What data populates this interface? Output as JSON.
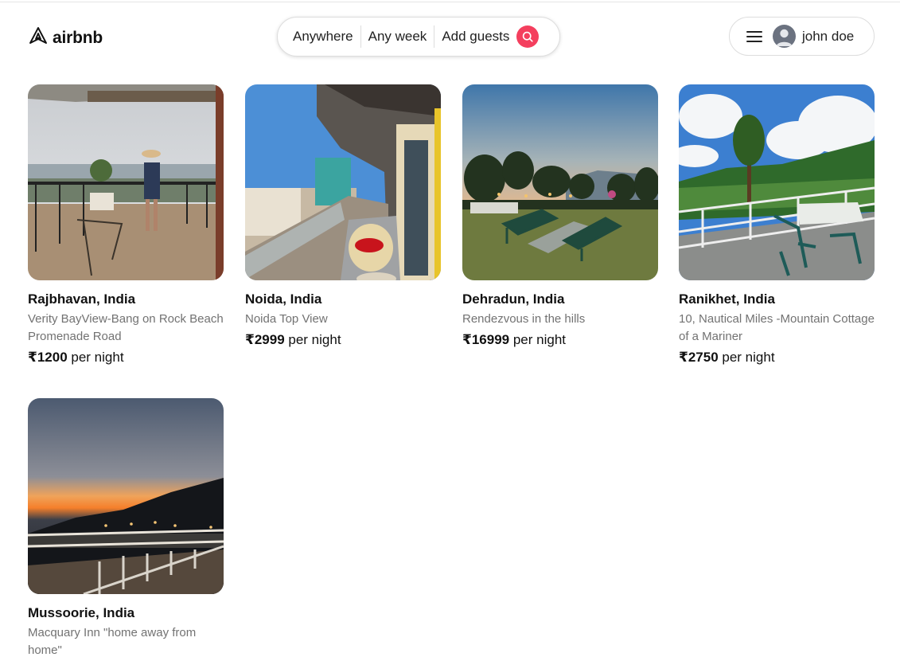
{
  "brand": {
    "name": "airbnb",
    "accent": "#f43f5e"
  },
  "search": {
    "where": "Anywhere",
    "when": "Any week",
    "who": "Add guests",
    "icon": "search-icon"
  },
  "user": {
    "name": "john doe",
    "menu_icon": "hamburger-icon",
    "avatar_icon": "user-avatar-icon"
  },
  "listings": [
    {
      "location": "Rajbhavan, India",
      "title": "Verity BayView-Bang on Rock Beach Promenade Road",
      "price": "₹1200",
      "unit": "per night"
    },
    {
      "location": "Noida, India",
      "title": "Noida Top View",
      "price": "₹2999",
      "unit": "per night"
    },
    {
      "location": "Dehradun, India",
      "title": "Rendezvous in the hills",
      "price": "₹16999",
      "unit": "per night"
    },
    {
      "location": "Ranikhet, India",
      "title": "10, Nautical Miles -Mountain Cottage of a Mariner",
      "price": "₹2750",
      "unit": "per night"
    },
    {
      "location": "Mussoorie, India",
      "title": "Macquary Inn \"home away from home\"",
      "price": "",
      "unit": ""
    }
  ]
}
